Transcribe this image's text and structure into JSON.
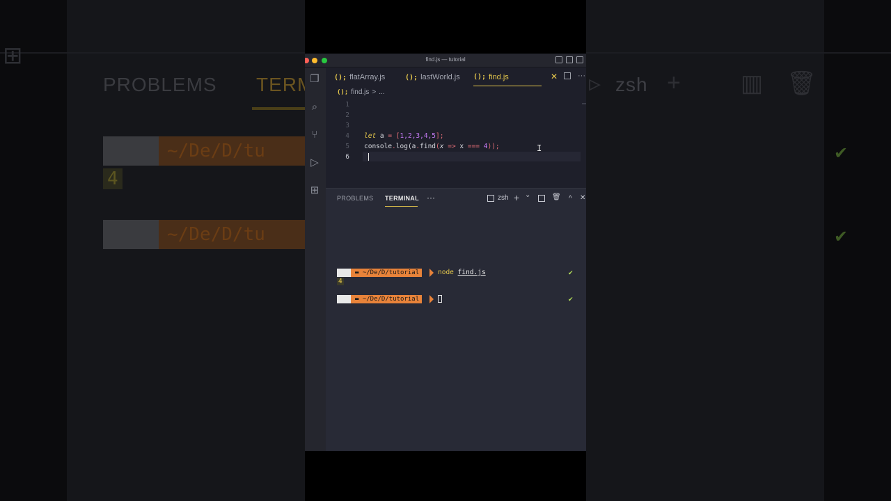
{
  "window": {
    "title": "find.js — tutorial"
  },
  "tabs": [
    {
      "icon": "();",
      "label": "flatArray.js"
    },
    {
      "icon": "();",
      "label": "lastWorld.js"
    },
    {
      "icon": "();",
      "label": "find.js"
    }
  ],
  "tab_close": "✕",
  "breadcrumb": {
    "icon": "();",
    "file": "find.js",
    "sep": ">",
    "rest": "..."
  },
  "editor": {
    "line_numbers": [
      "1",
      "2",
      "3",
      "4",
      "5",
      "6"
    ],
    "line4": {
      "kw": "let",
      "rest": " a ",
      "eq": "=",
      "arr_open": " [",
      "nums": "1,2,3,4,5",
      "arr_close": "];"
    },
    "line5": {
      "a": "console",
      "b": ".",
      "c": "log",
      "d": "(a",
      "e": ".",
      "f": "find",
      "g": "(",
      "h": "x",
      "i": " => ",
      "j": "x ",
      "k": "===",
      "l": " 4",
      "m": "));"
    }
  },
  "panel": {
    "tabs": [
      "PROBLEMS",
      "TERMINAL"
    ],
    "more": "···",
    "shell": "zsh",
    "plus": "+",
    "chev": "⌄",
    "up": "^",
    "close": "✕"
  },
  "terminal": {
    "path": "~/De/D/tutorial",
    "cmd_node": "node",
    "cmd_file": "find.js",
    "output": "4",
    "check": "✔"
  },
  "backdrop": {
    "problems": "PROBLEMS",
    "term": "TERM",
    "path": "~/De/D/tu",
    "output": "4",
    "shell": "zsh",
    "check": "✔"
  },
  "colors": {
    "accent": "#e6c84c",
    "prompt": "#e8833a",
    "check": "#b6e05a"
  }
}
